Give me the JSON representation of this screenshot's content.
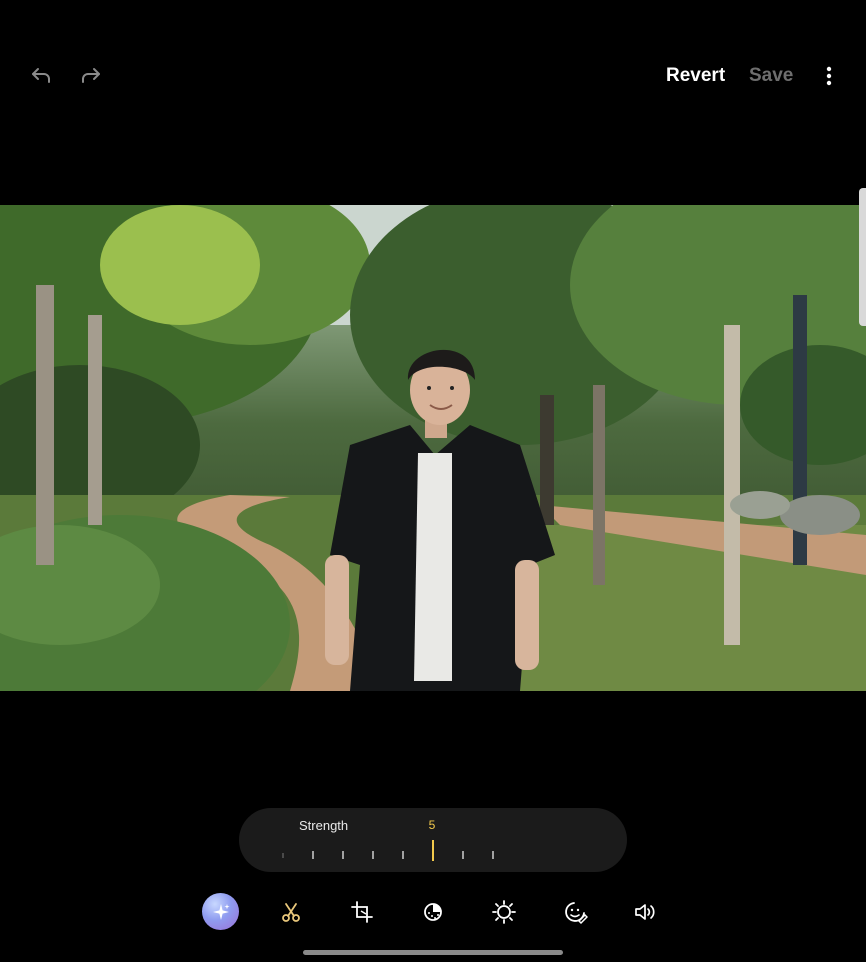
{
  "top_bar": {
    "undo_icon": "undo-arrow-icon",
    "redo_icon": "redo-arrow-icon",
    "revert_label": "Revert",
    "save_label": "Save",
    "more_icon": "more-vertical-icon"
  },
  "photo": {
    "description_icon": "photo-preview"
  },
  "strength": {
    "label": "Strength",
    "value": "5",
    "accent_color": "#f2c94c"
  },
  "toolbar": {
    "tools": [
      {
        "icon": "ai-sparkle-icon"
      },
      {
        "icon": "scissors-icon"
      },
      {
        "icon": "crop-rotate-icon"
      },
      {
        "icon": "filter-icon"
      },
      {
        "icon": "brightness-icon"
      },
      {
        "icon": "sticker-icon"
      },
      {
        "icon": "audio-icon"
      }
    ],
    "active_color": "#e9c77b"
  }
}
